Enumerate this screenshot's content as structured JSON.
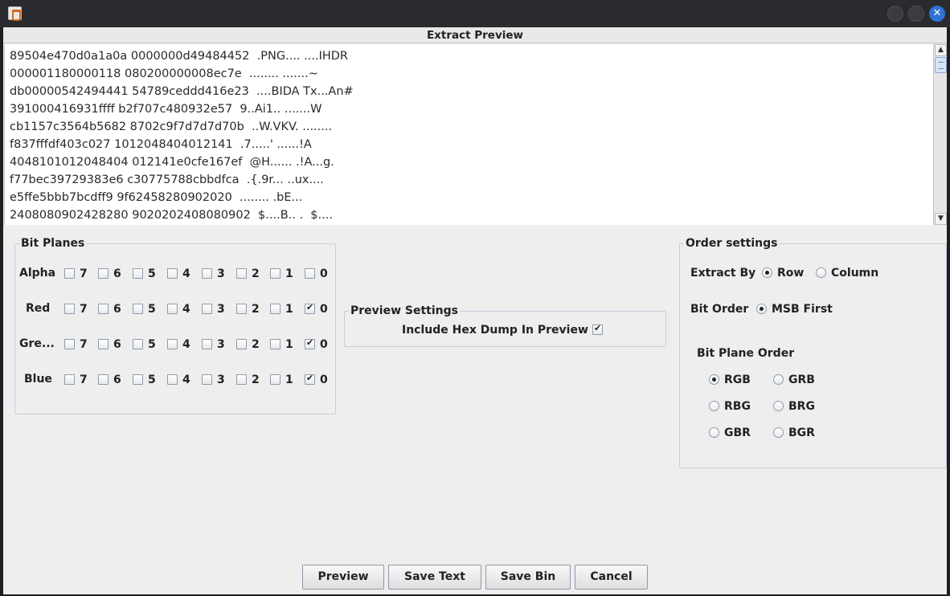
{
  "window": {
    "title": "",
    "preview_header": "Extract Preview"
  },
  "preview": {
    "lines": [
      "89504e470d0a1a0a 0000000d49484452  .PNG.... ....IHDR",
      "000001180000118 080200000008ec7e  ........ .......~",
      "db00000542494441 54789ceddd416e23  ....BIDA Tx...An#",
      "391000416931ffff b2f707c480932e57  9..Ai1.. .......W",
      "cb1157c3564b5682 8702c9f7d7d7d70b  ..W.VKV. ........",
      "f837fffdf403c027 1012048404012141  .7.....' ......!A",
      "4048101012048404 012141e0cfe167ef  @H...... .!A...g.",
      "f77bec39729383e6 c30775788cbbdfca  .{.9r... ..ux....",
      "e5ffe5bbb7bcdff9 9f62458280902020  ........ .bE...  ",
      "2408080902428280 9020202408080902  $....B.. .  $...."
    ]
  },
  "bit_planes": {
    "title": "Bit Planes",
    "bits": [
      "7",
      "6",
      "5",
      "4",
      "3",
      "2",
      "1",
      "0"
    ],
    "rows": [
      {
        "label": "Alpha",
        "checked": [
          false,
          false,
          false,
          false,
          false,
          false,
          false,
          false
        ]
      },
      {
        "label": "Red",
        "checked": [
          false,
          false,
          false,
          false,
          false,
          false,
          false,
          true
        ]
      },
      {
        "label": "Gre...",
        "checked": [
          false,
          false,
          false,
          false,
          false,
          false,
          false,
          true
        ]
      },
      {
        "label": "Blue",
        "checked": [
          false,
          false,
          false,
          false,
          false,
          false,
          false,
          true
        ]
      }
    ]
  },
  "preview_settings": {
    "title": "Preview Settings",
    "hex_dump_label": "Include Hex Dump In Preview",
    "hex_dump_checked": true
  },
  "order_settings": {
    "title": "Order settings",
    "extract_by_label": "Extract By",
    "extract_by_options": [
      "Row",
      "Column"
    ],
    "extract_by_selected": "Row",
    "bit_order_label": "Bit Order",
    "bit_order_options": [
      "MSB First"
    ],
    "bit_order_selected": "MSB First",
    "bit_plane_order_label": "Bit Plane Order",
    "bit_plane_order_options": [
      "RGB",
      "GRB",
      "RBG",
      "BRG",
      "GBR",
      "BGR"
    ],
    "bit_plane_order_selected": "RGB"
  },
  "buttons": {
    "preview": "Preview",
    "save_text": "Save Text",
    "save_bin": "Save Bin",
    "cancel": "Cancel"
  }
}
